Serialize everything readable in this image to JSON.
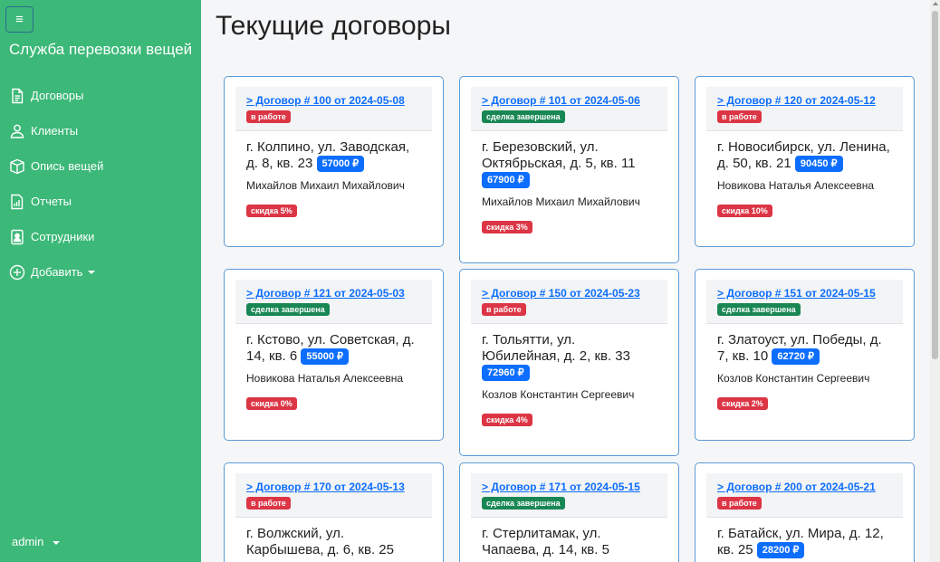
{
  "sidebar": {
    "toggle_icon": "hamburger-icon",
    "brand": "Служба перевозки вещей",
    "items": [
      {
        "label": "Договоры",
        "icon": "document-icon"
      },
      {
        "label": "Клиенты",
        "icon": "person-icon"
      },
      {
        "label": "Опись вещей",
        "icon": "box-icon"
      },
      {
        "label": "Отчеты",
        "icon": "report-icon"
      },
      {
        "label": "Сотрудники",
        "icon": "badge-icon"
      },
      {
        "label": "Добавить",
        "icon": "plus-circle-icon"
      }
    ],
    "user": "admin"
  },
  "main": {
    "title": "Текущие договоры",
    "contracts": [
      {
        "link": "> Договор # 100 от 2024-05-08",
        "status": "в работе",
        "status_color": "#dc3545",
        "address": "г. Колпино, ул. Заводская, д. 8, кв. 23",
        "price": "57000 ₽",
        "person": "Михайлов Михаил Михайлович",
        "discount": "скидка 5%"
      },
      {
        "link": "> Договор # 101 от 2024-05-06",
        "status": "сделка завершена",
        "status_color": "#198754",
        "address": "г. Березовский, ул. Октябрьская, д. 5, кв. 11",
        "price": "67900 ₽",
        "person": "Михайлов Михаил Михайлович",
        "discount": "скидка 3%"
      },
      {
        "link": "> Договор # 120 от 2024-05-12",
        "status": "в работе",
        "status_color": "#dc3545",
        "address": "г. Новосибирск, ул. Ленина, д. 50, кв. 21",
        "price": "90450 ₽",
        "person": "Новикова Наталья Алексеевна",
        "discount": "скидка 10%"
      },
      {
        "link": "> Договор # 121 от 2024-05-03",
        "status": "сделка завершена",
        "status_color": "#198754",
        "address": "г. Кстово, ул. Советская, д. 14, кв. 6",
        "price": "55000 ₽",
        "person": "Новикова Наталья Алексеевна",
        "discount": "скидка 0%"
      },
      {
        "link": "> Договор # 150 от 2024-05-23",
        "status": "в работе",
        "status_color": "#dc3545",
        "address": "г. Тольятти, ул. Юбилейная, д. 2, кв. 33",
        "price": "72960 ₽",
        "person": "Козлов Константин Сергеевич",
        "discount": "скидка 4%"
      },
      {
        "link": "> Договор # 151 от 2024-05-15",
        "status": "сделка завершена",
        "status_color": "#198754",
        "address": "г. Златоуст, ул. Победы, д. 7, кв. 10",
        "price": "62720 ₽",
        "person": "Козлов Константин Сергеевич",
        "discount": "скидка 2%"
      },
      {
        "link": "> Договор # 170 от 2024-05-13",
        "status": "в работе",
        "status_color": "#dc3545",
        "address": "г. Волжский, ул. Карбышева, д. 6, кв. 25",
        "price": "",
        "person": "",
        "discount": ""
      },
      {
        "link": "> Договор # 171 от 2024-05-15",
        "status": "сделка завершена",
        "status_color": "#198754",
        "address": "г. Стерлитамак, ул. Чапаева, д. 14, кв. 5",
        "price": "",
        "person": "",
        "discount": ""
      },
      {
        "link": "> Договор # 200 от 2024-05-21",
        "status": "в работе",
        "status_color": "#dc3545",
        "address": "г. Батайск, ул. Мира, д. 12, кв. 25",
        "price": "28200 ₽",
        "person": "",
        "discount": ""
      }
    ]
  }
}
